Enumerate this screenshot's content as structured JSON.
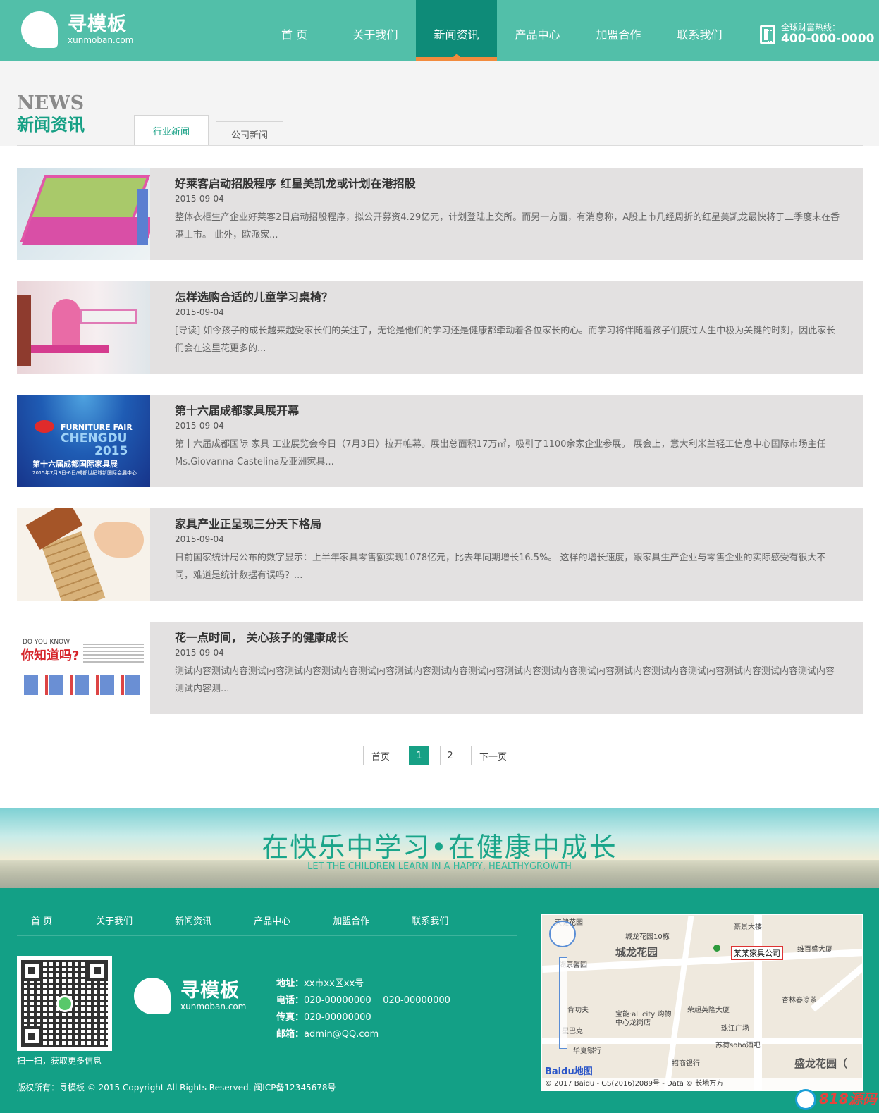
{
  "header": {
    "logo_cn": "寻模板",
    "logo_en": "xunmoban.com",
    "nav": [
      "首 页",
      "关于我们",
      "新闻资讯",
      "产品中心",
      "加盟合作",
      "联系我们"
    ],
    "active_nav_index": 2,
    "hotline_label": "全球财富热线：",
    "hotline_number": "400-000-0000"
  },
  "section": {
    "title_en": "NEWS",
    "title_cn": "新闻资讯",
    "tabs": [
      "行业新闻",
      "公司新闻"
    ],
    "active_tab_index": 0
  },
  "news": [
    {
      "title": "好莱客启动招股程序 红星美凯龙或计划在港招股",
      "date": "2015-09-04",
      "summary": "整体衣柜生产企业好莱客2日启动招股程序，拟公开募资4.29亿元，计划登陆上交所。而另一方面，有消息称，A股上市几经周折的红星美凯龙最快将于二季度末在香港上市。 此外，欧派家...",
      "thumb": "office-furniture-layout"
    },
    {
      "title": "怎样选购合适的儿童学习桌椅？",
      "date": "2015-09-04",
      "summary": "[导读] 如今孩子的成长越来越受家长们的关注了，无论是他们的学习还是健康都牵动着各位家长的心。而学习将伴随着孩子们度过人生中极为关键的时刻，因此家长们会在这里花更多的...",
      "thumb": "child-study-desk"
    },
    {
      "title": "第十六届成都家具展开幕",
      "date": "2015-09-04",
      "summary": "第十六届成都国际 家具 工业展览会今日（7月3日）拉开帷幕。展出总面积17万㎡，吸引了1100余家企业参展。 展会上，意大利米兰轻工信息中心国际市场主任Ms.Giovanna Castelina及亚洲家具...",
      "thumb": "furniture-fair-poster",
      "thumb_text": {
        "line1": "FURNITURE FAIR",
        "line2": "CHENGDU",
        "line3": "2015",
        "line4": "第十六届成都国际家具展",
        "line5": "2015年7月3日-6日/成都世纪城新国际会展中心"
      }
    },
    {
      "title": "家具产业正呈现三分天下格局",
      "date": "2015-09-04",
      "summary": "日前国家统计局公布的数字显示：上半年家具零售额实现1078亿元，比去年同期增长16.5%。 这样的增长速度，跟家具生产企业与零售企业的实际感受有很大不同，难道是统计数据有误吗？...",
      "thumb": "block-tower-house"
    },
    {
      "title": "花一点时间， 关心孩子的健康成长",
      "date": "2015-09-04",
      "summary": "测试内容测试内容测试内容测试内容测试内容测试内容测试内容测试内容测试内容测试内容测试内容测试内容测试内容测试内容测试内容测试内容测试内容测试内容测试内容测...",
      "thumb": "did-you-know-infographic",
      "thumb_text": {
        "q": "你知道吗?",
        "q0": "DO YOU KNOW"
      }
    }
  ],
  "pagination": {
    "first": "首页",
    "pages": [
      "1",
      "2"
    ],
    "current": "1",
    "next": "下一页"
  },
  "banner": {
    "cn": "在快乐中学习•在健康中成长",
    "en": "LET THE CHILDREN LEARN IN A HAPPY, HEALTHYGROWTH"
  },
  "footer": {
    "nav": [
      "首 页",
      "关于我们",
      "新闻资讯",
      "产品中心",
      "加盟合作",
      "联系我们"
    ],
    "qr_label": "扫一扫，获取更多信息",
    "logo_cn": "寻模板",
    "logo_en": "xunmoban.com",
    "address_label": "地址：",
    "address": "xx市xx区xx号",
    "phone_label": "电话：",
    "phone": "020-00000000    020-00000000",
    "fax_label": "传真：",
    "fax": "020-00000000",
    "email_label": "邮箱：",
    "email": "admin@QQ.com",
    "copyright": "版权所有：寻模板 © 2015 Copyright  All Rights Reserved. 闽ICP备12345678号"
  },
  "map": {
    "company": "某某家具公司",
    "labels": [
      "天健花园",
      "城龙花园10栋",
      "城龙花园",
      "豪景大楼",
      "维百盛大厦",
      "湖康馨园",
      "宝能·all city 购物中心龙岗店",
      "荣超英隆大厦",
      "珠江广场",
      "苏荷soho酒吧",
      "杏林春凉茶",
      "华夏银行",
      "招商银行",
      "盛龙花园（",
      "肯功夫",
      "星巴克"
    ],
    "copyright": "© 2017 Baidu - GS(2016)2089号 - Data © 长地万方",
    "brand_a": "Bai",
    "brand_b": "du",
    "brand_c": "地图"
  },
  "watermark": "818源码"
}
